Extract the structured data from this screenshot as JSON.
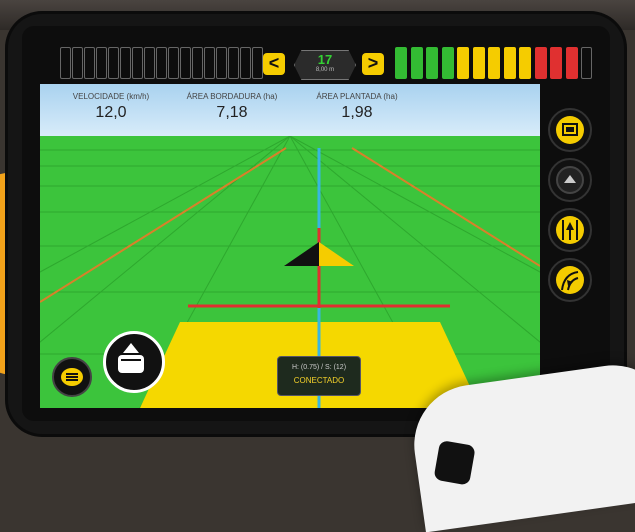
{
  "header": {
    "center_value": "17",
    "center_sub": "8,00 m",
    "prev_label": "<",
    "next_label": ">"
  },
  "lightbar": {
    "left_segments": 17,
    "right_colors": [
      "#33bb33",
      "#33bb33",
      "#33bb33",
      "#33bb33",
      "#f5cc00",
      "#f5cc00",
      "#f5cc00",
      "#f5cc00",
      "#f5cc00",
      "#e03030",
      "#e03030",
      "#e03030"
    ]
  },
  "stats": [
    {
      "label": "VELOCIDADE (km/h)",
      "value": "12,0"
    },
    {
      "label": "ÁREA BORDADURA (ha)",
      "value": "7,18"
    },
    {
      "label": "ÁREA PLANTADA (ha)",
      "value": "1,98"
    }
  ],
  "status": {
    "line1": "H: (0.75) / S: (12)",
    "line2": "CONECTADO"
  },
  "side_buttons": [
    "layers-icon",
    "up-arrow-icon",
    "guidance-lines-icon",
    "curve-guidance-icon"
  ],
  "colors": {
    "accent": "#f5cc00",
    "field": "#3cc43c",
    "guide_line": "#38b6e0",
    "swath_line": "#e03030"
  }
}
